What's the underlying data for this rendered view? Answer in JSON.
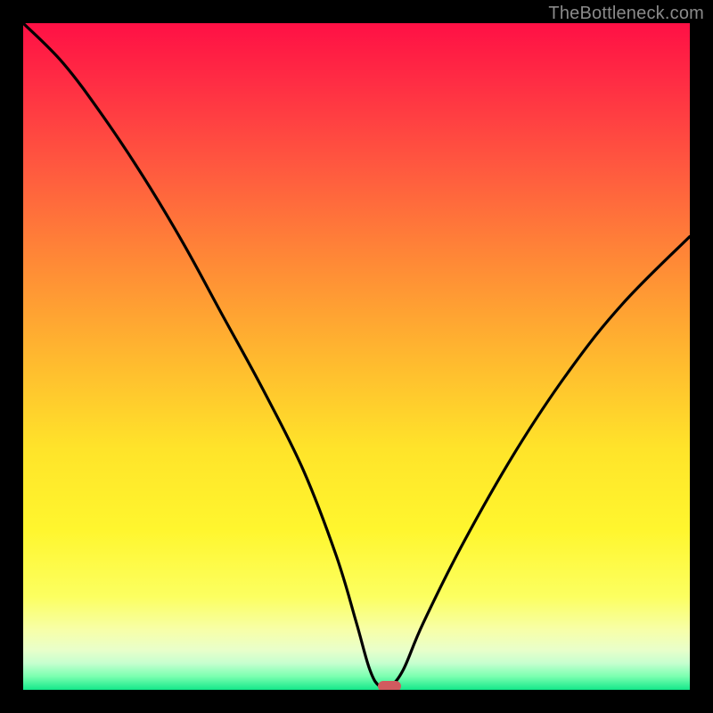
{
  "watermark": "TheBottleneck.com",
  "chart_data": {
    "type": "line",
    "title": "",
    "xlabel": "",
    "ylabel": "",
    "xlim": [
      0,
      100
    ],
    "ylim": [
      0,
      100
    ],
    "background_gradient": {
      "top_color": "#ff1045",
      "bottom_color": "#14e88a",
      "meaning_top": "high bottleneck",
      "meaning_bottom": "no bottleneck"
    },
    "series": [
      {
        "name": "bottleneck-curve",
        "x": [
          0,
          6,
          12,
          18,
          24,
          30,
          36,
          42,
          47,
          50,
          52,
          53.5,
          55,
          57,
          60,
          66,
          74,
          82,
          90,
          100
        ],
        "y": [
          100,
          94,
          86,
          77,
          67,
          56,
          45,
          33,
          20,
          10,
          3,
          0.5,
          0.5,
          3,
          10,
          22,
          36,
          48,
          58,
          68
        ]
      }
    ],
    "marker": {
      "name": "optimal-point",
      "x": 55,
      "y": 0.5,
      "color": "#d15a5f"
    }
  }
}
